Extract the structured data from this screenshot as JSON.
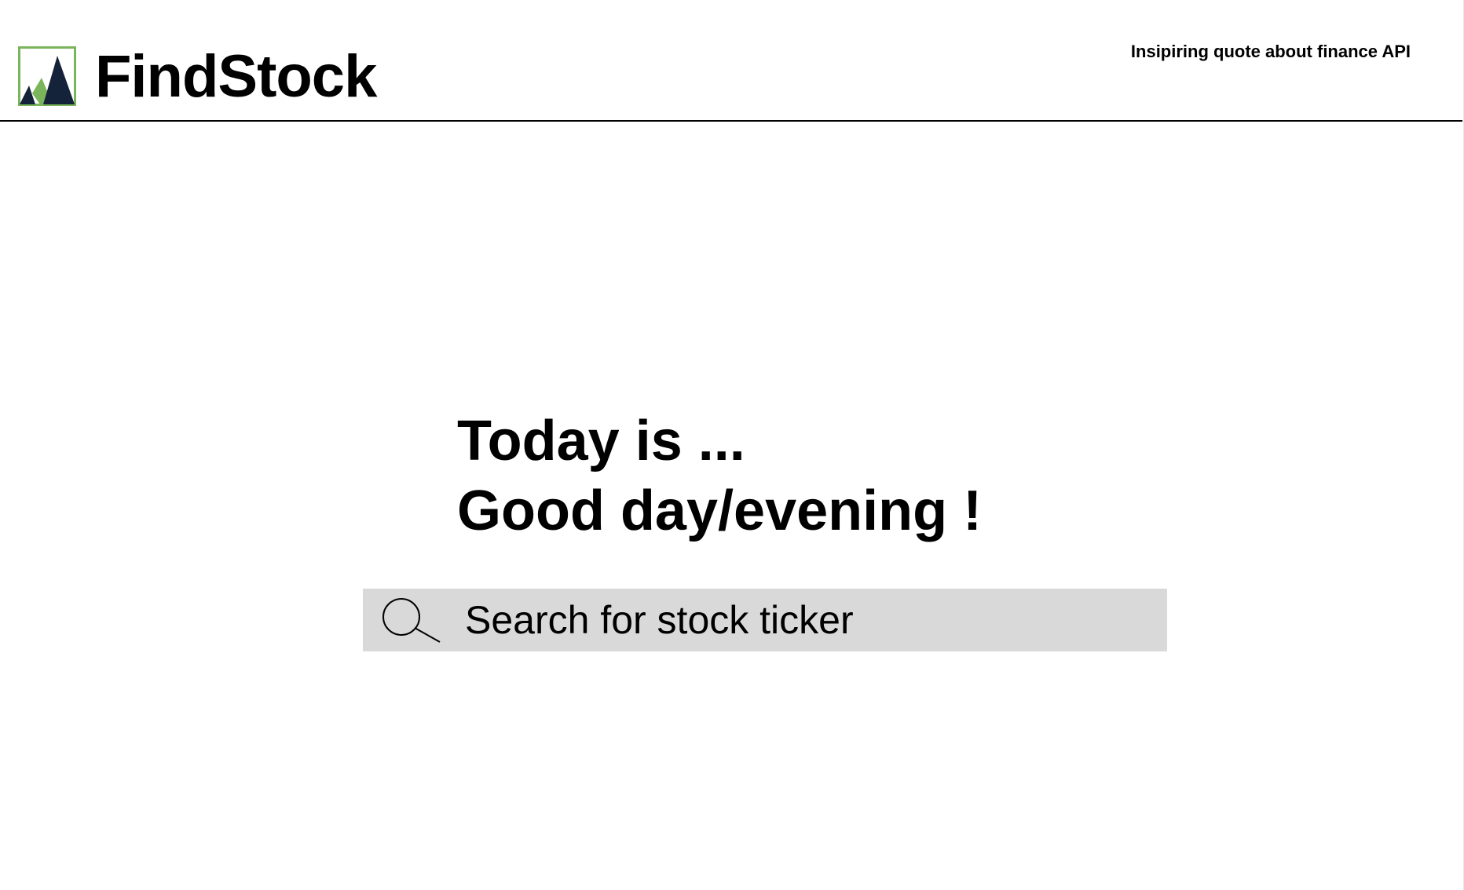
{
  "header": {
    "brand": "FindStock",
    "quote": "Insipiring quote about finance API"
  },
  "hero": {
    "line1": "Today is ...",
    "line2": "Good day/evening !"
  },
  "search": {
    "placeholder": "Search for stock ticker",
    "value": ""
  },
  "icons": {
    "logo": "findstock-logo-icon",
    "search": "search-icon"
  },
  "colors": {
    "background": "#ffffff",
    "logo_green": "#7ab55c",
    "logo_navy": "#14233a",
    "search_bg": "#d9d9d9",
    "text": "#000000"
  }
}
